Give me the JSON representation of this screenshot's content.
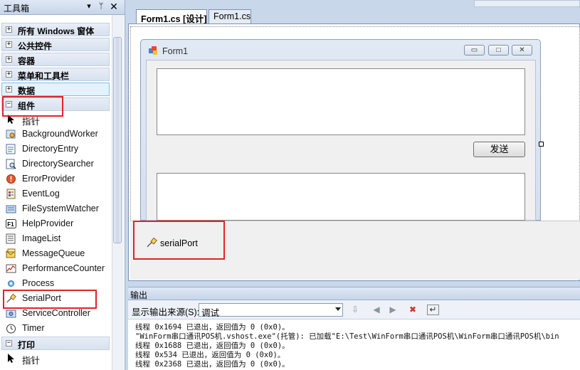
{
  "toolbox": {
    "title": "工具箱",
    "categories": [
      {
        "label": "所有 Windows 窗体",
        "sign": "+"
      },
      {
        "label": "公共控件",
        "sign": "+"
      },
      {
        "label": "容器",
        "sign": "+"
      },
      {
        "label": "菜单和工具栏",
        "sign": "+"
      },
      {
        "label": "数据",
        "sign": "+"
      },
      {
        "label": "组件",
        "sign": "−"
      }
    ],
    "items": [
      {
        "label": "指针",
        "icon": "pointer-icon"
      },
      {
        "label": "BackgroundWorker",
        "icon": "background-worker-icon"
      },
      {
        "label": "DirectoryEntry",
        "icon": "directory-entry-icon"
      },
      {
        "label": "DirectorySearcher",
        "icon": "directory-searcher-icon"
      },
      {
        "label": "ErrorProvider",
        "icon": "error-provider-icon"
      },
      {
        "label": "EventLog",
        "icon": "event-log-icon"
      },
      {
        "label": "FileSystemWatcher",
        "icon": "file-system-watcher-icon"
      },
      {
        "label": "HelpProvider",
        "icon": "help-provider-icon"
      },
      {
        "label": "ImageList",
        "icon": "image-list-icon"
      },
      {
        "label": "MessageQueue",
        "icon": "message-queue-icon"
      },
      {
        "label": "PerformanceCounter",
        "icon": "performance-counter-icon"
      },
      {
        "label": "Process",
        "icon": "process-icon"
      },
      {
        "label": "SerialPort",
        "icon": "serial-port-icon"
      },
      {
        "label": "ServiceController",
        "icon": "service-controller-icon"
      },
      {
        "label": "Timer",
        "icon": "timer-icon"
      }
    ],
    "print_category": {
      "label": "打印",
      "sign": "−"
    },
    "print_item": {
      "label": "指针",
      "icon": "pointer-icon"
    }
  },
  "designer": {
    "tabs": [
      "Form1.cs [设计]",
      "Form1.cs"
    ],
    "form_title": "Form1",
    "send_button": "发送",
    "tray_component": "serialPort"
  },
  "output": {
    "title": "输出",
    "source_label": "显示输出来源(S):",
    "source_value": "调试",
    "lines": [
      "线程 0x1694 已退出，返回值为 0 (0x0)。",
      "\"WinForm串口通讯POS机.vshost.exe\"(托管): 已加载\"E:\\Test\\WinForm串口通讯POS机\\WinForm串口通讯POS机\\bin",
      "线程 0x1688 已退出，返回值为 0 (0x0)。",
      "线程 0x534 已退出，返回值为 0 (0x0)。",
      "线程 0x2368 已退出，返回值为 0 (0x0)。"
    ]
  },
  "colors": {
    "accent_highlight": "#e3222a",
    "selected_category": "#e4f2fb",
    "panel_bg": "#c9d7ea"
  }
}
